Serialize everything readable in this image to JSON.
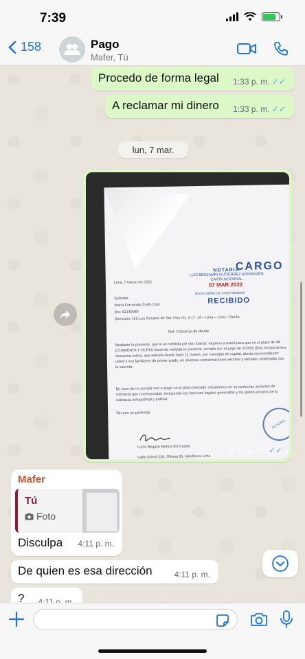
{
  "status": {
    "time": "7:39"
  },
  "header": {
    "back_count": "158",
    "title": "Pago",
    "subtitle": "Mafer, Tú"
  },
  "messages": [
    {
      "text": "Procedo de forma legal",
      "time": "1:33 p. m.",
      "ticks": "✓✓"
    },
    {
      "text": "A reclamar mi dinero",
      "time": "1:33 p. m.",
      "ticks": "✓✓"
    }
  ],
  "date_divider": "lun, 7 mar.",
  "photo_message": {
    "time": "3:17 p. m.",
    "ticks": "✓✓",
    "doc": {
      "cargo": "CARGO",
      "notaria": "NOTARIA",
      "notary_name": "LUIS BENJAMÍN GUTIÉRREZ ADRIANZÉN",
      "notary_line2": "CARTA NOTARIAL",
      "date_stamp": "07 MAR 2022",
      "stamp_note": "NO ES SEÑAL DE CONFORMIDAD",
      "recibido": "RECIBIDO",
      "place_date": "Lima, 7 marzo de 2022",
      "salutation": "Señorita:",
      "recipient": "María Fernanda Giulfo Díaz",
      "dni": "Dni: 62149086",
      "address": "Dirección: Urb Los Rosales de Sta. Ines mz. A LT. 14 – Lima – Lima – Breña",
      "ref": "Ref: Cobranza de deuda",
      "body1": "Mediante la presente, que le es remitida por vía notarial, requiero a usted para que en el plazo de 48 (CUARENTA Y OCHO) horas de recibida la presente, cumpla con el pago de S/2550 (Dos mil quinientos cincuenta soles), que adeuda desde hace 11 meses, por concepto de capital, deuda reconocida por usted y sus familiares de primer grado, en diversas comunicaciones escritas y verbales sostenidas con la suscrita.",
      "body2": "En caso de no cumplir con el pago en el plazo indicado, iniciaremos en su contra las acciones de cobranza que correspondan, incluyendo los intereses legales generados y los gastos propios de la cobranza extrajudicial y judicial.",
      "closing": "Sin otro en particular,",
      "signer": "Lucía Begazo Muñoz del Carpio",
      "signer_addr": "Calle Schell 120. Oficina 25. Miraflores Lima"
    }
  },
  "incoming": {
    "sender": "Mafer",
    "quote_name": "Tú",
    "quote_label": "Foto",
    "text": "Disculpa",
    "time": "4:11 p. m."
  },
  "incoming2": {
    "text": "De quien es esa dirección",
    "time": "4:11 p. m."
  },
  "incoming3": {
    "text": "?",
    "time": "4:11 p. m."
  },
  "input": {
    "placeholder": ""
  },
  "colors": {
    "out_bubble": "#dcf8c6",
    "accent": "#1a73e8",
    "sender": "#c25530"
  }
}
